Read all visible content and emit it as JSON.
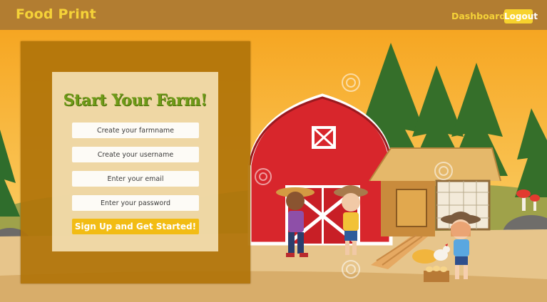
{
  "header": {
    "brand": "Food Print",
    "nav_dashboard": "Dashboard",
    "logout_label": "Logout"
  },
  "signup_form": {
    "title": "Start Your Farm!",
    "farmname_placeholder": "Create your farmname",
    "username_placeholder": "Create your username",
    "email_placeholder": "Enter your email",
    "password_placeholder": "Enter your password",
    "submit_label": "Sign Up and Get Started!"
  },
  "colors": {
    "header_bg": "#b27d31",
    "brand_yellow": "#f5d238",
    "panel_bg": "#b0740a",
    "title_green": "#6e9a17",
    "button_yellow": "#f2bc14",
    "barn_red": "#d8262c"
  }
}
